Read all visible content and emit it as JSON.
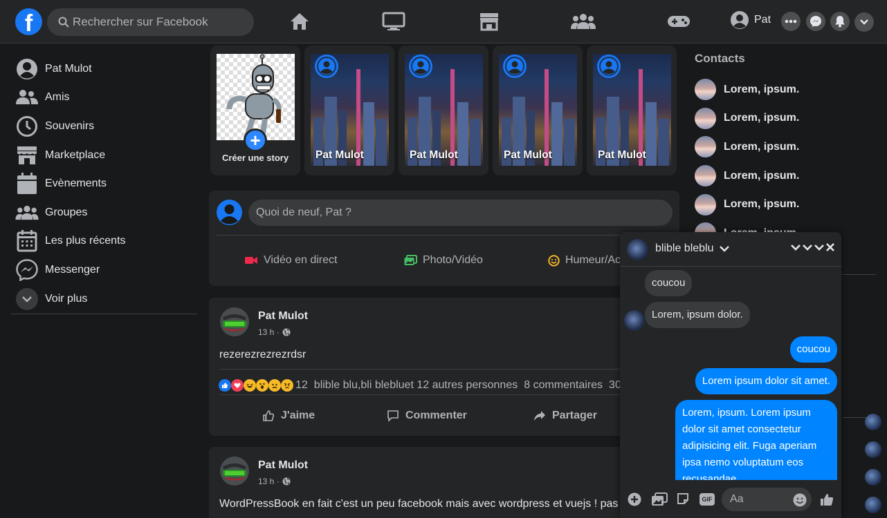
{
  "topbar": {
    "logo_letter": "f",
    "search_placeholder": "Rechercher sur Facebook",
    "nav_icons": [
      "home-icon",
      "watch-icon",
      "marketplace-icon",
      "groups-icon",
      "gaming-icon"
    ],
    "profile_name": "Pat",
    "right_icons": [
      "menu-icon",
      "messenger-icon",
      "notifications-icon",
      "account-chevron-icon"
    ]
  },
  "sidebar": {
    "items": [
      {
        "label": "Pat Mulot",
        "icon": "profile-icon"
      },
      {
        "label": "Amis",
        "icon": "friends-icon"
      },
      {
        "label": "Souvenirs",
        "icon": "clock-icon"
      },
      {
        "label": "Marketplace",
        "icon": "store-icon"
      },
      {
        "label": "Evènements",
        "icon": "calendar-icon"
      },
      {
        "label": "Groupes",
        "icon": "groups-icon"
      },
      {
        "label": "Les plus récents",
        "icon": "calendar-grid-icon"
      },
      {
        "label": "Messenger",
        "icon": "messenger-icon"
      },
      {
        "label": "Voir plus",
        "icon": "chevron-down-icon"
      }
    ]
  },
  "stories": {
    "create_label": "Créer une story",
    "items": [
      {
        "name": "Pat Mulot"
      },
      {
        "name": "Pat Mulot"
      },
      {
        "name": "Pat Mulot"
      },
      {
        "name": "Pat Mulot"
      }
    ]
  },
  "composer": {
    "placeholder": "Quoi de neuf, Pat ?",
    "actions": [
      {
        "label": "Vidéo en direct",
        "color": "#f02849"
      },
      {
        "label": "Photo/Vidéo",
        "color": "#45bd62"
      },
      {
        "label": "Humeur/Ac",
        "color": "#f7b928"
      }
    ]
  },
  "posts": [
    {
      "author": "Pat Mulot",
      "time": "13 h ·",
      "text": "rezerezrezrezrdsr",
      "reaction_count": "12",
      "reaction_names": "blible blu,bli blebluet 12 autres personnes",
      "comments": "8 commentaires",
      "shares": "30",
      "like_label": "J'aime",
      "comment_label": "Commenter",
      "share_label": "Partager"
    },
    {
      "author": "Pat Mulot",
      "time": "13 h ·",
      "text": "WordPressBook en fait c'est un peu facebook mais avec wordpress et vuejs ! pas ?"
    }
  ],
  "contacts": {
    "heading": "Contacts",
    "items": [
      "Lorem, ipsum.",
      "Lorem, ipsum.",
      "Lorem, ipsum.",
      "Lorem, ipsum.",
      "Lorem, ipsum.",
      "Lorem, ipsum."
    ]
  },
  "chat": {
    "name": "blible bleblu",
    "messages": [
      {
        "from": "them",
        "text": "coucou"
      },
      {
        "from": "them",
        "text": "Lorem, ipsum dolor."
      },
      {
        "from": "me",
        "text": "coucou"
      },
      {
        "from": "me",
        "text": "Lorem ipsum dolor sit amet."
      },
      {
        "from": "me",
        "text": "Lorem, ipsum. Lorem ipsum dolor sit amet consectetur adipisicing elit. Fuga aperiam ipsa nemo voluptatum eos recusandae"
      }
    ],
    "input_placeholder": "Aa",
    "footer_icons": [
      "add-icon",
      "image-icon",
      "sticker-icon",
      "gif-icon",
      "emoji-icon",
      "thumbs-up-icon"
    ],
    "gif_label": "GIF"
  },
  "colors": {
    "accent": "#1877f2",
    "bubble_out": "#0084ff",
    "background": "#18191a",
    "surface": "#242526"
  }
}
